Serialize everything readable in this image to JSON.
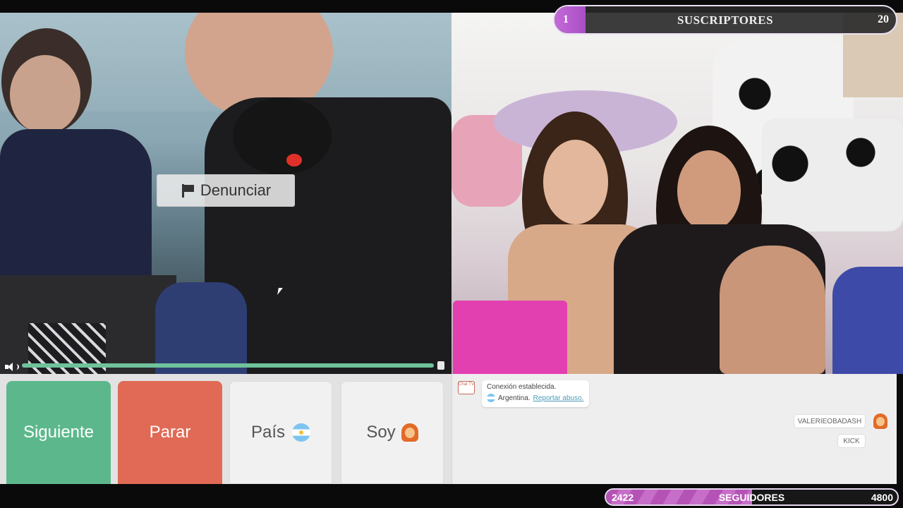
{
  "report_button": {
    "label": "Denunciar"
  },
  "volume": {
    "level": 0.98
  },
  "controls": {
    "next_label": "Siguiente",
    "stop_label": "Parar",
    "country_label": "País",
    "gender_label": "Soy"
  },
  "chat": {
    "logo_text": "Chat TV",
    "system_message": {
      "line1": "Conexión establecida.",
      "country": "Argentina.",
      "report_link": "Reportar abuso."
    },
    "username_chip": "VALERIEOBADASH",
    "kick_chip": "KICK"
  },
  "subscribers_overlay": {
    "current": "1",
    "label": "SUSCRIPTORES",
    "goal": "20",
    "progress": 0.05
  },
  "followers_overlay": {
    "current": "2422",
    "label": "SEGUIDORES",
    "goal": "4800",
    "progress": 0.5
  },
  "colors": {
    "next": "#5cb88c",
    "stop": "#e06a55",
    "volume": "#6fc29a",
    "subs_fill": "#c46ad7",
    "follow_fill": "#b453b5"
  }
}
